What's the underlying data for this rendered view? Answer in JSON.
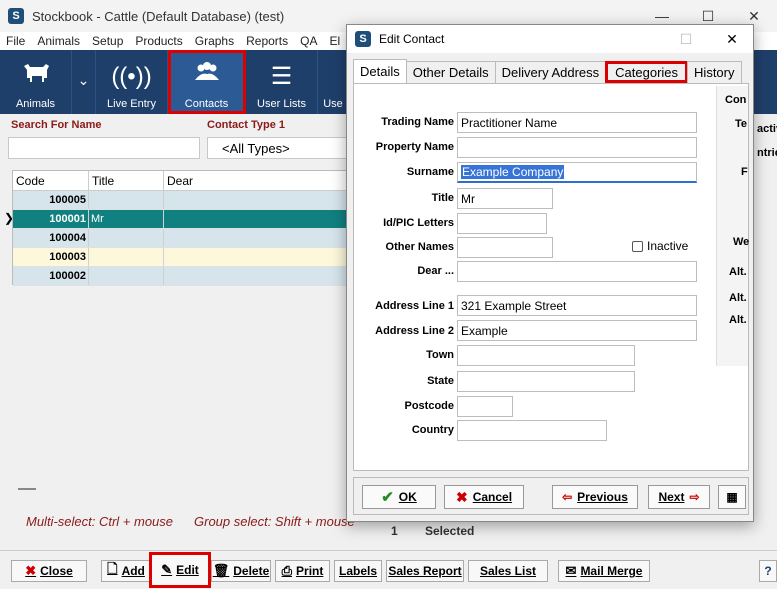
{
  "window": {
    "title": "Stockbook - Cattle (Default Database) (test)",
    "minimize": "—",
    "maximize": "☐",
    "close": "✕"
  },
  "menu": [
    "File",
    "Animals",
    "Setup",
    "Products",
    "Graphs",
    "Reports",
    "QA",
    "El"
  ],
  "toolbar": {
    "animals": "Animals",
    "live_entry": "Live Entry",
    "contacts": "Contacts",
    "user_lists": "User Lists",
    "user_partial": "Use"
  },
  "filters": {
    "search_label": "Search For Name",
    "contact_type_label": "Contact Type 1",
    "contact_type_value": "<All Types>"
  },
  "grid": {
    "headers": [
      "Code",
      "Title",
      "Dear"
    ],
    "rows": [
      {
        "code": "100005",
        "title": "",
        "dear": ""
      },
      {
        "code": "100001",
        "title": "Mr",
        "dear": ""
      },
      {
        "code": "100004",
        "title": "",
        "dear": ""
      },
      {
        "code": "100003",
        "title": "",
        "dear": ""
      },
      {
        "code": "100002",
        "title": "",
        "dear": ""
      }
    ]
  },
  "hints": {
    "multi": "Multi-select: Ctrl + mouse",
    "group": "Group select: Shift + mouse",
    "count": "1",
    "selected": "Selected"
  },
  "bottom_buttons": {
    "close": "Close",
    "add": "Add",
    "edit": "Edit",
    "delete": "Delete",
    "print": "Print",
    "labels": "Labels",
    "sales_report": "Sales Report",
    "sales_list": "Sales List",
    "mail_merge": "Mail Merge",
    "help": "?"
  },
  "dialog": {
    "title": "Edit Contact",
    "tabs": [
      "Details",
      "Other Details",
      "Delivery Address",
      "Categories",
      "History"
    ],
    "fields": {
      "trading_name": {
        "label": "Trading Name",
        "value": "Practitioner Name"
      },
      "property_name": {
        "label": "Property Name",
        "value": ""
      },
      "surname": {
        "label": "Surname",
        "value": "Example Company"
      },
      "title": {
        "label": "Title",
        "value": "Mr"
      },
      "id_pic": {
        "label": "Id/PIC Letters",
        "value": ""
      },
      "other_names": {
        "label": "Other Names",
        "value": ""
      },
      "dear": {
        "label": "Dear ...",
        "value": ""
      },
      "address1": {
        "label": "Address Line 1",
        "value": "321 Example Street"
      },
      "address2": {
        "label": "Address Line 2",
        "value": "Example"
      },
      "town": {
        "label": "Town",
        "value": ""
      },
      "state": {
        "label": "State",
        "value": ""
      },
      "postcode": {
        "label": "Postcode",
        "value": ""
      },
      "country": {
        "label": "Country",
        "value": ""
      }
    },
    "inactive_label": "Inactive",
    "side_partial": [
      "Con",
      "Te",
      "F",
      "We",
      "Alt.",
      "Alt.",
      "Alt."
    ],
    "buttons": {
      "ok": "OK",
      "cancel": "Cancel",
      "previous": "Previous",
      "next": "Next"
    }
  },
  "behind_partial": [
    "activ",
    "ntries"
  ]
}
